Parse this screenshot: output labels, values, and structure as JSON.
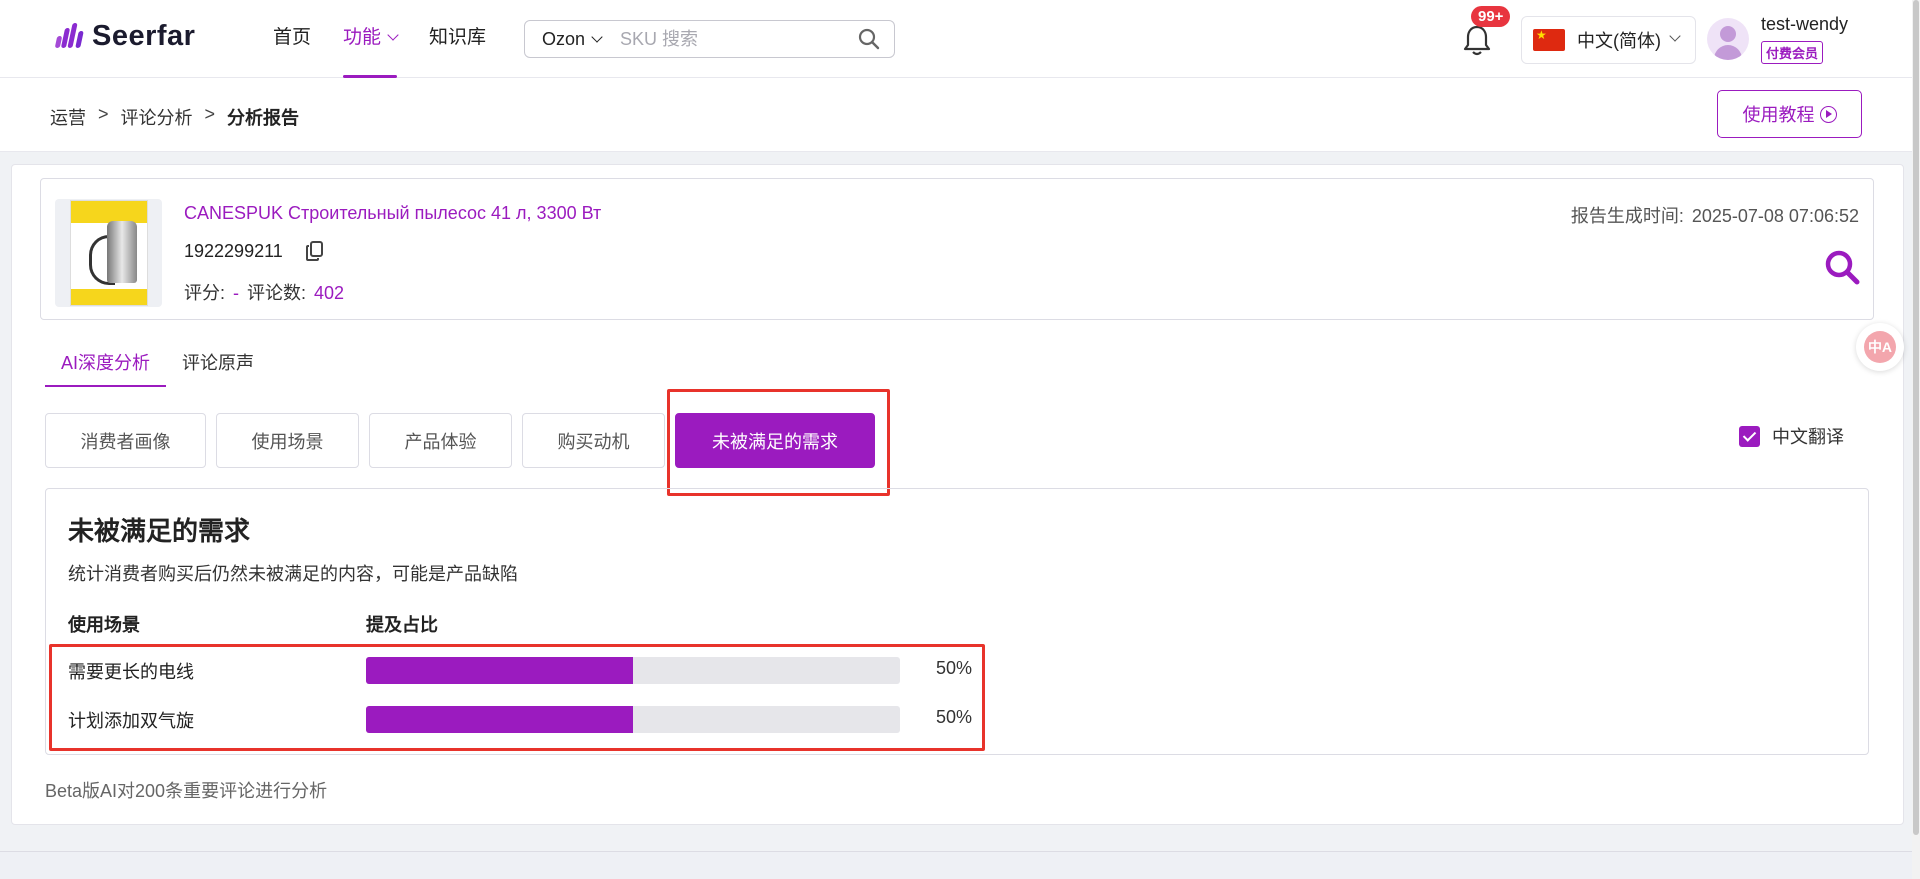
{
  "header": {
    "logo_text": "Seerfar",
    "nav": [
      {
        "label": "首页"
      },
      {
        "label": "功能"
      },
      {
        "label": "知识库"
      }
    ],
    "search": {
      "platform": "Ozon",
      "placeholder": "SKU 搜索"
    },
    "notifications_badge": "99+",
    "language": "中文(简体)",
    "username": "test-wendy",
    "member_label": "付费会员"
  },
  "breadcrumb": {
    "items": [
      "运营",
      "评论分析"
    ],
    "current": "分析报告",
    "separator": ">"
  },
  "tutorial_label": "使用教程",
  "product": {
    "title": "CANESPUK Строительный пылесос 41 л, 3300 Вт",
    "sku": "1922299211",
    "rating_label": "评分:",
    "rating_value": "-",
    "reviews_label": "评论数:",
    "reviews_value": "402",
    "report_time_label": "报告生成时间:",
    "report_time_value": "2025-07-08 07:06:52"
  },
  "tabs": [
    {
      "label": "AI深度分析"
    },
    {
      "label": "评论原声"
    }
  ],
  "subtabs": [
    {
      "label": "消费者画像"
    },
    {
      "label": "使用场景"
    },
    {
      "label": "产品体验"
    },
    {
      "label": "购买动机"
    },
    {
      "label": "未被满足的需求"
    }
  ],
  "translate_toggle": {
    "label": "中文翻译",
    "checked": true
  },
  "panel": {
    "title": "未被满足的需求",
    "description": "统计消费者购买后仍然未被满足的内容，可能是产品缺陷",
    "col_scene": "使用场景",
    "col_ratio": "提及占比",
    "rows": [
      {
        "label": "需要更长的电线",
        "ratio": 0.5,
        "ratio_text": "50%"
      },
      {
        "label": "计划添加双气旋",
        "ratio": 0.5,
        "ratio_text": "50%"
      }
    ]
  },
  "footnote": "Beta版AI对200条重要评论进行分析",
  "translate_float_text": "中A",
  "colors": {
    "accent": "#9b1bbf",
    "highlight": "#e8332b",
    "badge": "#e8353f"
  }
}
